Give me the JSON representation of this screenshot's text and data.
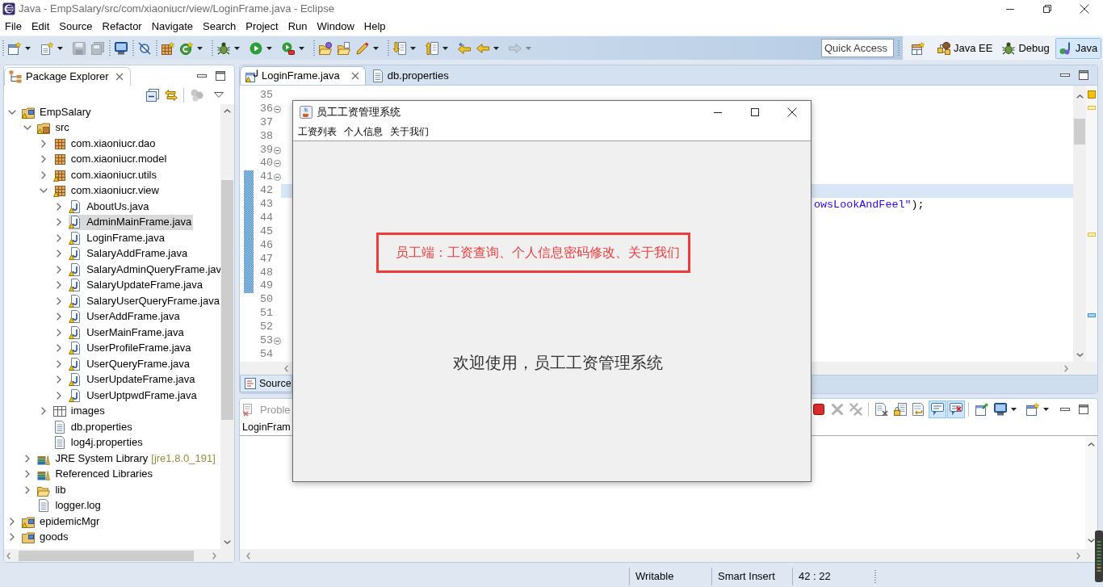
{
  "window": {
    "title": "Java - EmpSalary/src/com/xiaoniucr/view/LoginFrame.java - Eclipse"
  },
  "menu": [
    "File",
    "Edit",
    "Source",
    "Refactor",
    "Navigate",
    "Search",
    "Project",
    "Run",
    "Window",
    "Help"
  ],
  "toolbar": {
    "groups": [
      [
        {
          "kind": "new-wizard",
          "dropdown": true,
          "disabled": false
        },
        {
          "kind": "new-file",
          "dropdown": true,
          "disabled": false
        },
        {
          "kind": "save",
          "dropdown": false,
          "disabled": true
        },
        {
          "kind": "save-all",
          "dropdown": false,
          "disabled": true
        }
      ],
      [
        {
          "kind": "console",
          "dropdown": false,
          "disabled": false
        }
      ],
      [
        {
          "kind": "skip-breakpoints",
          "dropdown": false,
          "disabled": false
        }
      ],
      [
        {
          "kind": "new-package",
          "dropdown": false,
          "disabled": false
        },
        {
          "kind": "new-class",
          "dropdown": true,
          "disabled": false
        }
      ],
      [
        {
          "kind": "debug",
          "dropdown": true,
          "disabled": false
        },
        {
          "kind": "run",
          "dropdown": true,
          "disabled": false
        },
        {
          "kind": "external-tools",
          "dropdown": true,
          "disabled": false
        }
      ],
      [
        {
          "kind": "open-type",
          "dropdown": false,
          "disabled": false
        },
        {
          "kind": "open-task",
          "dropdown": false,
          "disabled": false
        },
        {
          "kind": "search",
          "dropdown": true,
          "disabled": false
        }
      ],
      [
        {
          "kind": "next-annotation",
          "dropdown": true,
          "disabled": false
        },
        {
          "kind": "previous-annotation",
          "dropdown": true,
          "disabled": false
        },
        {
          "kind": "last-edit",
          "dropdown": false,
          "disabled": false
        },
        {
          "kind": "back",
          "dropdown": true,
          "disabled": false
        },
        {
          "kind": "forward",
          "dropdown": true,
          "disabled": true
        }
      ]
    ],
    "quick_access": {
      "placeholder": "Quick Access"
    },
    "perspectives": [
      {
        "label": "Java EE",
        "kind": "java-ee",
        "selected": false
      },
      {
        "label": "Debug",
        "kind": "debug",
        "selected": false
      },
      {
        "label": "Java",
        "kind": "java",
        "selected": true
      }
    ]
  },
  "package_explorer": {
    "title": "Package Explorer",
    "toolbar": [
      [
        {
          "kind": "collapse-all",
          "disabled": false
        },
        {
          "kind": "link-editor",
          "disabled": false
        }
      ],
      [
        {
          "kind": "focus-task",
          "disabled": true
        }
      ]
    ],
    "tree": [
      {
        "label": "EmpSalary",
        "kind": "project",
        "expanded": true,
        "selected": false,
        "warning": true,
        "children": [
          {
            "label": "src",
            "kind": "source-folder",
            "expanded": true,
            "selected": false,
            "warning": true,
            "children": [
              {
                "label": "com.xiaoniucr.dao",
                "kind": "package",
                "expanded": false,
                "selected": false,
                "warning": false
              },
              {
                "label": "com.xiaoniucr.model",
                "kind": "package",
                "expanded": false,
                "selected": false,
                "warning": false
              },
              {
                "label": "com.xiaoniucr.utils",
                "kind": "package",
                "expanded": false,
                "selected": false,
                "warning": true
              },
              {
                "label": "com.xiaoniucr.view",
                "kind": "package",
                "expanded": true,
                "selected": false,
                "warning": true,
                "children": [
                  {
                    "label": "AboutUs.java",
                    "kind": "java-file",
                    "expanded": false,
                    "selected": false,
                    "warning": true
                  },
                  {
                    "label": "AdminMainFrame.java",
                    "kind": "java-file",
                    "expanded": false,
                    "selected": true,
                    "warning": true
                  },
                  {
                    "label": "LoginFrame.java",
                    "kind": "java-file",
                    "expanded": false,
                    "selected": false,
                    "warning": true
                  },
                  {
                    "label": "SalaryAddFrame.java",
                    "kind": "java-file",
                    "expanded": false,
                    "selected": false,
                    "warning": true
                  },
                  {
                    "label": "SalaryAdminQueryFrame.jav",
                    "kind": "java-file",
                    "expanded": false,
                    "selected": false,
                    "warning": true
                  },
                  {
                    "label": "SalaryUpdateFrame.java",
                    "kind": "java-file",
                    "expanded": false,
                    "selected": false,
                    "warning": true
                  },
                  {
                    "label": "SalaryUserQueryFrame.java",
                    "kind": "java-file",
                    "expanded": false,
                    "selected": false,
                    "warning": true
                  },
                  {
                    "label": "UserAddFrame.java",
                    "kind": "java-file",
                    "expanded": false,
                    "selected": false,
                    "warning": true
                  },
                  {
                    "label": "UserMainFrame.java",
                    "kind": "java-file",
                    "expanded": false,
                    "selected": false,
                    "warning": true
                  },
                  {
                    "label": "UserProfileFrame.java",
                    "kind": "java-file",
                    "expanded": false,
                    "selected": false,
                    "warning": true
                  },
                  {
                    "label": "UserQueryFrame.java",
                    "kind": "java-file",
                    "expanded": false,
                    "selected": false,
                    "warning": true
                  },
                  {
                    "label": "UserUpdateFrame.java",
                    "kind": "java-file",
                    "expanded": false,
                    "selected": false,
                    "warning": true
                  },
                  {
                    "label": "UserUptpwdFrame.java",
                    "kind": "java-file",
                    "expanded": false,
                    "selected": false,
                    "warning": true
                  }
                ]
              },
              {
                "label": "images",
                "kind": "folder-grid",
                "expanded": false,
                "selected": false,
                "warning": false
              },
              {
                "label": "db.properties",
                "kind": "file",
                "selected": false,
                "warning": false
              },
              {
                "label": "log4j.properties",
                "kind": "file",
                "selected": false,
                "warning": false
              }
            ]
          },
          {
            "label": "JRE System Library",
            "decoration": "[jre1.8.0_191]",
            "kind": "library",
            "expanded": false,
            "selected": false,
            "warning": false
          },
          {
            "label": "Referenced Libraries",
            "kind": "library",
            "expanded": false,
            "selected": false,
            "warning": false
          },
          {
            "label": "lib",
            "kind": "folder",
            "expanded": false,
            "selected": false,
            "warning": false
          },
          {
            "label": "logger.log",
            "kind": "file",
            "selected": false,
            "warning": false
          }
        ]
      },
      {
        "label": "epidemicMgr",
        "kind": "project",
        "expanded": false,
        "selected": false,
        "warning": true
      },
      {
        "label": "goods",
        "kind": "project",
        "expanded": false,
        "selected": false,
        "warning": false
      }
    ]
  },
  "editor": {
    "tabs": [
      {
        "label": "LoginFrame.java",
        "kind": "java-form",
        "warning": true,
        "selected": true
      },
      {
        "label": "db.properties",
        "kind": "file",
        "warning": false,
        "selected": false
      }
    ],
    "lines": [
      {
        "number": "35",
        "fold": false,
        "current": false,
        "in_range": false
      },
      {
        "number": "36",
        "fold": true,
        "current": false,
        "in_range": false
      },
      {
        "number": "37",
        "fold": false,
        "current": false,
        "in_range": false
      },
      {
        "number": "38",
        "fold": false,
        "current": false,
        "in_range": false
      },
      {
        "number": "39",
        "fold": true,
        "current": false,
        "in_range": false
      },
      {
        "number": "40",
        "fold": true,
        "current": false,
        "in_range": false
      },
      {
        "number": "41",
        "fold": true,
        "current": false,
        "in_range": true
      },
      {
        "number": "42",
        "fold": false,
        "current": true,
        "in_range": true
      },
      {
        "number": "43",
        "fold": false,
        "current": false,
        "in_range": true,
        "code": [
          {
            "text": "owsLookAndFeel\"",
            "kind": "string"
          },
          {
            "text": ");",
            "kind": "plain"
          }
        ]
      },
      {
        "number": "44",
        "fold": false,
        "current": false,
        "in_range": true
      },
      {
        "number": "45",
        "fold": false,
        "current": false,
        "in_range": true
      },
      {
        "number": "46",
        "fold": false,
        "current": false,
        "in_range": true
      },
      {
        "number": "47",
        "fold": false,
        "current": false,
        "in_range": true
      },
      {
        "number": "48",
        "fold": false,
        "current": false,
        "in_range": true
      },
      {
        "number": "49",
        "fold": false,
        "current": false,
        "in_range": true
      },
      {
        "number": "50",
        "fold": false,
        "current": false,
        "in_range": false
      },
      {
        "number": "51",
        "fold": false,
        "current": false,
        "in_range": false
      },
      {
        "number": "52",
        "fold": false,
        "current": false,
        "in_range": false
      },
      {
        "number": "53",
        "fold": true,
        "current": false,
        "in_range": false
      },
      {
        "number": "54",
        "fold": false,
        "current": false,
        "in_range": false
      }
    ],
    "overview_summary": {
      "kind": "warning"
    },
    "overview_markers": [
      {
        "kind": "warning"
      },
      {
        "kind": "warning"
      },
      {
        "kind": "occurrence"
      }
    ],
    "bottom_tabs": [
      {
        "label": "Source",
        "selected": true
      }
    ]
  },
  "console": {
    "tabs": [
      {
        "label": "Proble",
        "selected": false
      }
    ],
    "toolbar": [
      [
        {
          "kind": "stop",
          "disabled": false
        },
        {
          "kind": "remove",
          "disabled": true
        },
        {
          "kind": "remove-all",
          "disabled": true
        }
      ],
      [
        {
          "kind": "clear",
          "on": false
        },
        {
          "kind": "scroll-lock",
          "on": false
        },
        {
          "kind": "word-wrap",
          "on": false
        },
        {
          "kind": "show-on-output",
          "on": true
        },
        {
          "kind": "show-on-error",
          "on": true
        }
      ],
      [
        {
          "kind": "pin",
          "dropdown": false
        },
        {
          "kind": "display",
          "dropdown": true
        },
        {
          "kind": "new-console",
          "dropdown": true
        }
      ]
    ],
    "description": "LoginFram"
  },
  "status_bar": [
    "Writable",
    "Smart Insert",
    "42 : 22"
  ],
  "dialog": {
    "title": "员工工资管理系统",
    "menu": [
      "工资列表",
      "个人信息",
      "关于我们"
    ],
    "notice": "员工端：工资查询、个人信息密码修改、关于我们",
    "welcome": "欢迎使用，员工工资管理系统"
  }
}
